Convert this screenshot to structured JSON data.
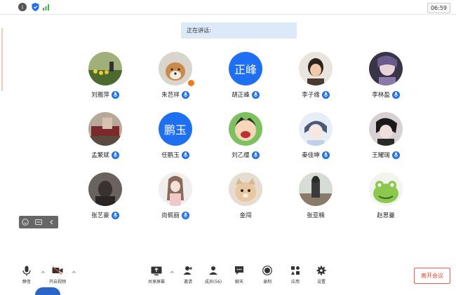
{
  "status_bar": {
    "time": "06:59"
  },
  "speaking": {
    "label": "正在讲话:"
  },
  "participants": [
    {
      "name": "刘雅萍",
      "avatar_type": "photo",
      "avatar_desc": "outdoor field",
      "mic": true
    },
    {
      "name": "朱芑祥",
      "avatar_type": "photo",
      "avatar_desc": "dog",
      "mic": true,
      "badge": true
    },
    {
      "name": "胡正峰",
      "avatar_type": "text",
      "avatar_text": "正峰",
      "mic": true
    },
    {
      "name": "李子缘",
      "avatar_type": "photo",
      "avatar_desc": "portrait",
      "mic": true
    },
    {
      "name": "李林盈",
      "avatar_type": "photo",
      "avatar_desc": "anime",
      "mic": true
    },
    {
      "name": "孟繁斌",
      "avatar_type": "photo",
      "avatar_desc": "room",
      "mic": true
    },
    {
      "name": "任鹏玉",
      "avatar_type": "text",
      "avatar_text": "鹏玉",
      "mic": true
    },
    {
      "name": "刘乙缨",
      "avatar_type": "photo",
      "avatar_desc": "cartoon",
      "mic": true
    },
    {
      "name": "秦佳坤",
      "avatar_type": "photo",
      "avatar_desc": "anime boy",
      "mic": true
    },
    {
      "name": "王耀瑞",
      "avatar_type": "photo",
      "avatar_desc": "dark portrait",
      "mic": true
    },
    {
      "name": "张艺豪",
      "avatar_type": "photo",
      "avatar_desc": "portrait",
      "mic": true
    },
    {
      "name": "尚佩丽",
      "avatar_type": "photo",
      "avatar_desc": "illustration",
      "mic": true
    },
    {
      "name": "金闯",
      "avatar_type": "photo",
      "avatar_desc": "cat",
      "mic": false
    },
    {
      "name": "张亚楠",
      "avatar_type": "photo",
      "avatar_desc": "outdoor",
      "mic": false
    },
    {
      "name": "赵思曼",
      "avatar_type": "photo",
      "avatar_desc": "frog cartoon",
      "mic": false
    }
  ],
  "toolbar": {
    "mute": "静音",
    "start_video": "开启视频",
    "share_screen": "共享屏幕",
    "invite": "邀请",
    "members": "成员(56)",
    "chat": "聊天",
    "record": "录制",
    "apps": "应用",
    "settings": "设置",
    "leave": "离开会议"
  },
  "colors": {
    "accent": "#1e6ff2",
    "leave": "#e04a2b",
    "speaking_bg": "#dce9f9"
  }
}
